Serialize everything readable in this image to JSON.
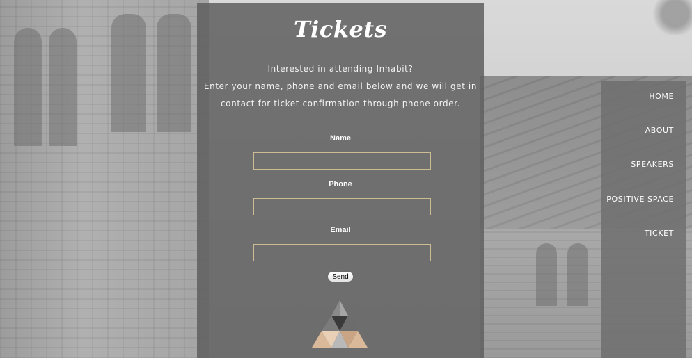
{
  "panel": {
    "title": "Tickets",
    "intro": [
      "Interested in attending Inhabit?",
      "Enter your name, phone and email below and we will get in",
      "contact for ticket confirmation through phone order."
    ],
    "fields": {
      "name_label": "Name",
      "name_value": "",
      "phone_label": "Phone",
      "phone_value": "",
      "email_label": "Email",
      "email_value": ""
    },
    "send_label": "Send",
    "logo_icon": "triangle-logo-icon"
  },
  "nav": {
    "items": [
      "HOME",
      "ABOUT",
      "SPEAKERS",
      "POSITIVE SPACE",
      "TICKET"
    ]
  },
  "colors": {
    "panel_bg": "#606060",
    "input_border": "#cdbb94",
    "logo_tan": "#d9b99a"
  }
}
